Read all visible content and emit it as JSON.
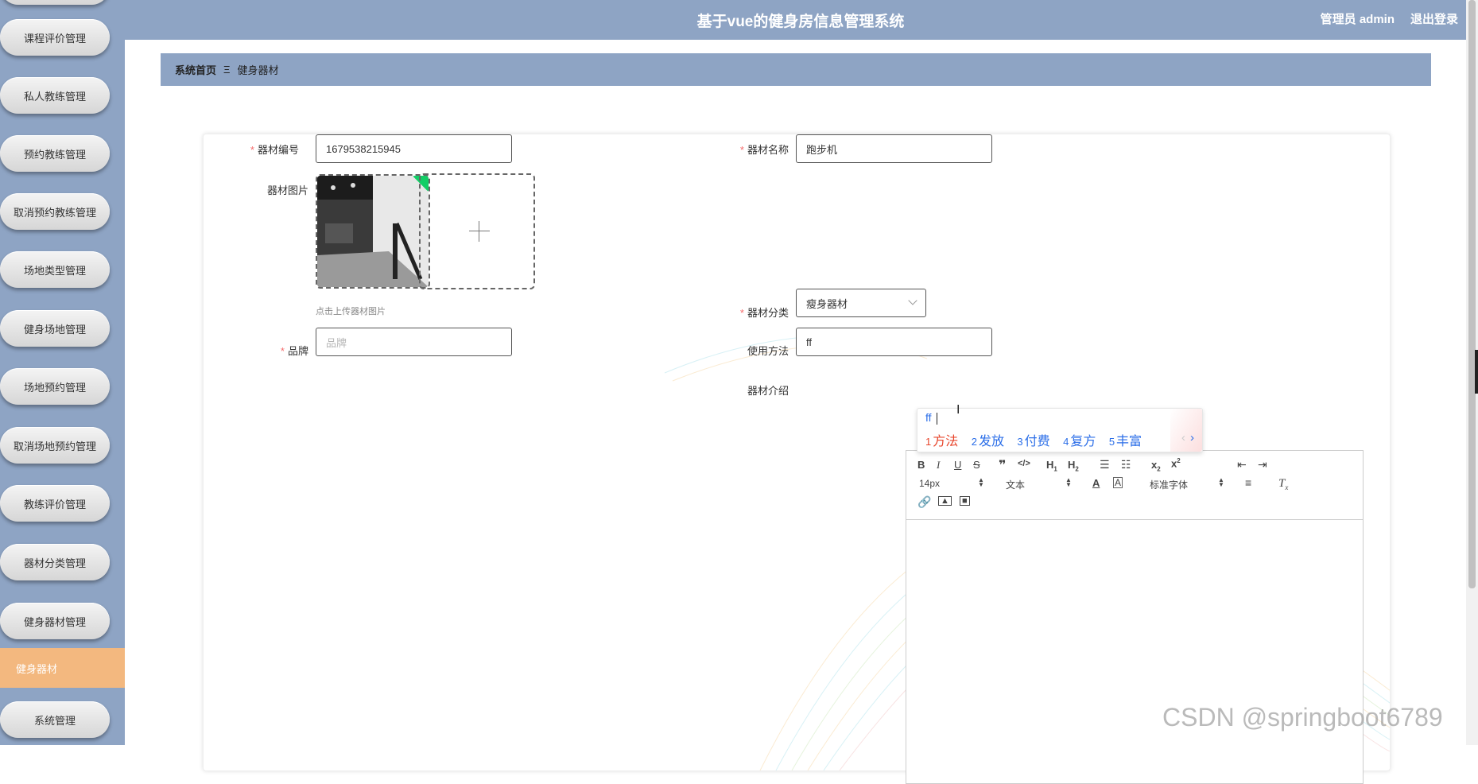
{
  "header": {
    "title": "基于vue的健身房信息管理系统",
    "user": "管理员 admin",
    "logout": "退出登录"
  },
  "sidebar": {
    "items": [
      "课程评价管理",
      "私人教练管理",
      "预约教练管理",
      "取消预约教练管理",
      "场地类型管理",
      "健身场地管理",
      "场地预约管理",
      "取消场地预约管理",
      "教练评价管理",
      "器材分类管理",
      "健身器材管理"
    ],
    "active": "健身器材",
    "after": "系统管理"
  },
  "breadcrumb": {
    "home": "系统首页",
    "sep": "Ξ",
    "current": "健身器材"
  },
  "form": {
    "equipment_no_label": "器材编号",
    "equipment_no_value": "1679538215945",
    "equipment_name_label": "器材名称",
    "equipment_name_value": "跑步机",
    "image_label": "器材图片",
    "upload_hint": "点击上传器材图片",
    "category_label": "器材分类",
    "category_value": "瘦身器材",
    "brand_label": "品牌",
    "brand_placeholder": "品牌",
    "usage_label": "使用方法",
    "usage_value": "ff",
    "intro_label": "器材介绍",
    "required_mark": "*"
  },
  "editor": {
    "font_size": "14px",
    "paragraph": "文本",
    "font_family": "标准字体"
  },
  "ime": {
    "input": "ff",
    "candidates": [
      {
        "n": "1",
        "text": "方法"
      },
      {
        "n": "2",
        "text": "发放"
      },
      {
        "n": "3",
        "text": "付费"
      },
      {
        "n": "4",
        "text": "复方"
      },
      {
        "n": "5",
        "text": "丰富"
      }
    ],
    "prev": "‹",
    "next": "›"
  },
  "watermark": "CSDN @springboot6789",
  "colors": {
    "header": "#8ea4c4",
    "active_menu": "#f3b87f",
    "required": "#f56c6c",
    "ime_blue": "#2b6ee8",
    "ime_first": "#e8452b"
  }
}
